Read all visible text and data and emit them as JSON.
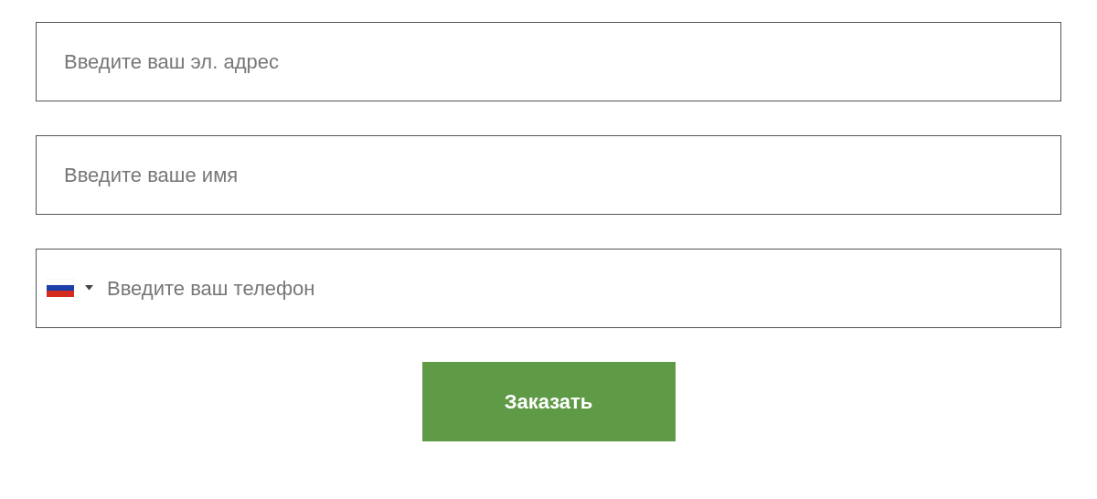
{
  "fields": [
    {
      "kind": "text",
      "placeholder": "Введите ваш эл. адрес"
    },
    {
      "kind": "text",
      "placeholder": "Введите ваше имя"
    },
    {
      "kind": "phone",
      "placeholder": "Введите ваш телефон"
    }
  ],
  "submit_button": {
    "label": "Заказать"
  }
}
